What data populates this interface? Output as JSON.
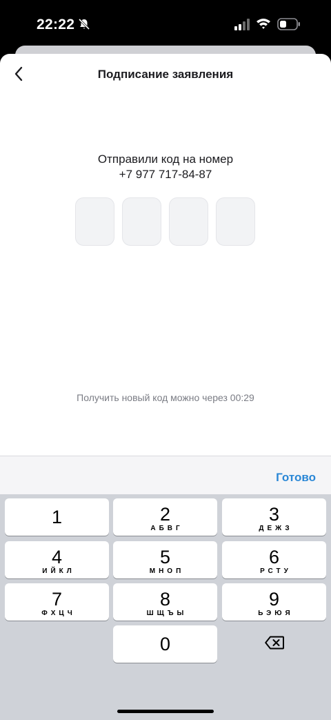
{
  "status_bar": {
    "time": "22:22"
  },
  "header": {
    "title": "Подписание заявления"
  },
  "main": {
    "sent_text": "Отправили код на номер",
    "phone": "+7 977 717-84-87",
    "resend_text": "Получить новый код можно через 00:29"
  },
  "keyboard": {
    "done_label": "Готово",
    "keys": [
      {
        "num": "1",
        "letters": ""
      },
      {
        "num": "2",
        "letters": "АБВГ"
      },
      {
        "num": "3",
        "letters": "ДЕЖЗ"
      },
      {
        "num": "4",
        "letters": "ИЙКЛ"
      },
      {
        "num": "5",
        "letters": "МНОП"
      },
      {
        "num": "6",
        "letters": "РСТУ"
      },
      {
        "num": "7",
        "letters": "ФХЦЧ"
      },
      {
        "num": "8",
        "letters": "ШЩЪЫ"
      },
      {
        "num": "9",
        "letters": "ЬЭЮЯ"
      },
      {
        "num": "0",
        "letters": ""
      }
    ]
  },
  "icons": {
    "back": "chevron-left-icon",
    "bell_off": "bell-off-icon",
    "cellular": "cellular-icon",
    "wifi": "wifi-icon",
    "battery": "battery-icon",
    "delete": "backspace-icon"
  },
  "colors": {
    "accent": "#2a87d6",
    "code_cell_bg": "#f2f3f5",
    "keypad_bg": "#cfd2d8"
  }
}
